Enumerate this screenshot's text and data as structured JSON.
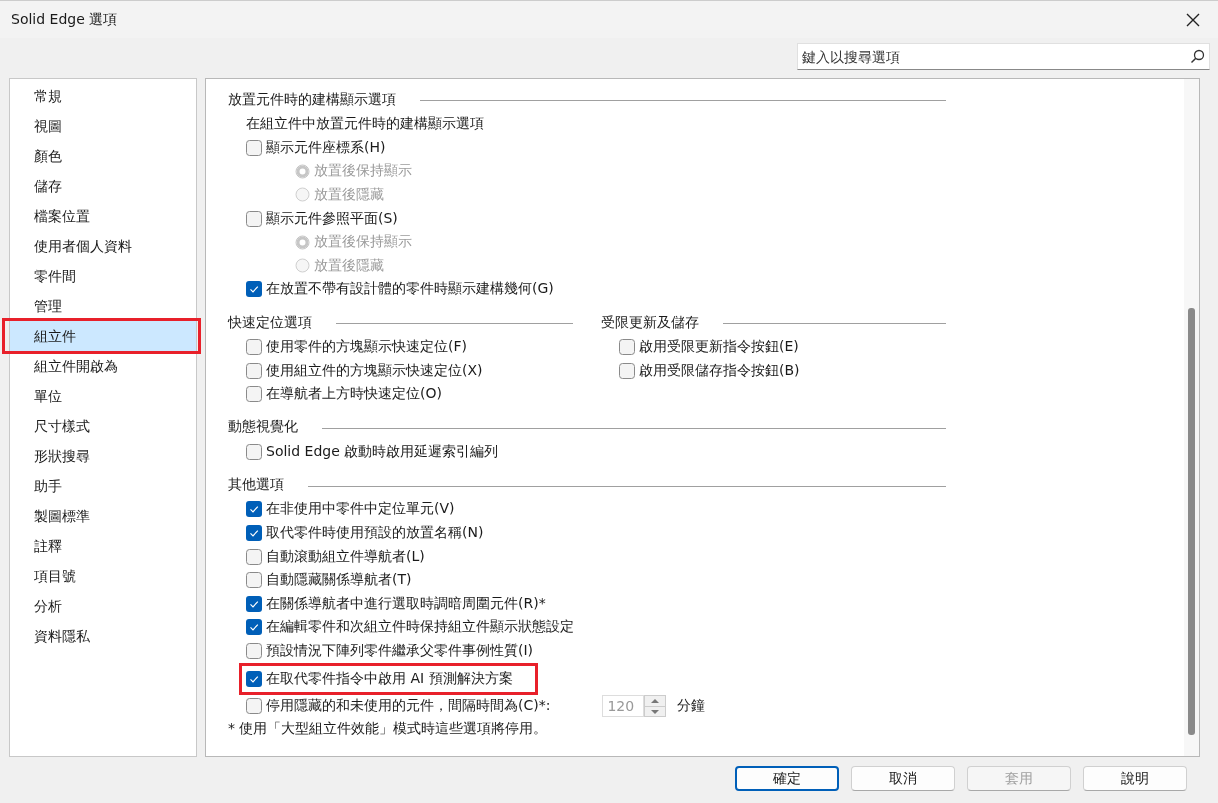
{
  "window": {
    "title": "Solid Edge 選項"
  },
  "search": {
    "placeholder": "鍵入以搜尋選項"
  },
  "sidebar": {
    "items": [
      {
        "label": "常規",
        "selected": false,
        "highlighted": false
      },
      {
        "label": "視圖",
        "selected": false,
        "highlighted": false
      },
      {
        "label": "顏色",
        "selected": false,
        "highlighted": false
      },
      {
        "label": "儲存",
        "selected": false,
        "highlighted": false
      },
      {
        "label": "檔案位置",
        "selected": false,
        "highlighted": false
      },
      {
        "label": "使用者個人資料",
        "selected": false,
        "highlighted": false
      },
      {
        "label": "零件間",
        "selected": false,
        "highlighted": false
      },
      {
        "label": "管理",
        "selected": false,
        "highlighted": false
      },
      {
        "label": "組立件",
        "selected": true,
        "highlighted": true
      },
      {
        "label": "組立件開啟為",
        "selected": false,
        "highlighted": false
      },
      {
        "label": "單位",
        "selected": false,
        "highlighted": false
      },
      {
        "label": "尺寸樣式",
        "selected": false,
        "highlighted": false
      },
      {
        "label": "形狀搜尋",
        "selected": false,
        "highlighted": false
      },
      {
        "label": "助手",
        "selected": false,
        "highlighted": false
      },
      {
        "label": "製圖標準",
        "selected": false,
        "highlighted": false
      },
      {
        "label": "註釋",
        "selected": false,
        "highlighted": false
      },
      {
        "label": "項目號",
        "selected": false,
        "highlighted": false
      },
      {
        "label": "分析",
        "selected": false,
        "highlighted": false
      },
      {
        "label": "資料隱私",
        "selected": false,
        "highlighted": false
      }
    ]
  },
  "content": {
    "rows": [
      [
        {
          "title": "放置元件時的建構顯示選項",
          "items": [
            {
              "kind": "text",
              "label": "在組立件中放置元件時的建構顯示選項"
            },
            {
              "kind": "checkbox",
              "label": "顯示元件座標系(H)",
              "checked": false,
              "children": [
                {
                  "kind": "radio",
                  "label": "放置後保持顯示",
                  "selected": true,
                  "disabled": true
                },
                {
                  "kind": "radio",
                  "label": "放置後隱藏",
                  "selected": false,
                  "disabled": true
                }
              ]
            },
            {
              "kind": "checkbox",
              "label": "顯示元件參照平面(S)",
              "checked": false,
              "children": [
                {
                  "kind": "radio",
                  "label": "放置後保持顯示",
                  "selected": true,
                  "disabled": true
                },
                {
                  "kind": "radio",
                  "label": "放置後隱藏",
                  "selected": false,
                  "disabled": true
                }
              ]
            },
            {
              "kind": "checkbox",
              "label": "在放置不帶有設計體的零件時顯示建構幾何(G)",
              "checked": true
            }
          ]
        }
      ],
      [
        {
          "title": "快速定位選項",
          "items": [
            {
              "kind": "checkbox",
              "label": "使用零件的方塊顯示快速定位(F)",
              "checked": false
            },
            {
              "kind": "checkbox",
              "label": "使用組立件的方塊顯示快速定位(X)",
              "checked": false
            },
            {
              "kind": "checkbox",
              "label": "在導航者上方時快速定位(O)",
              "checked": false
            }
          ]
        },
        {
          "title": "受限更新及儲存",
          "items": [
            {
              "kind": "checkbox",
              "label": "啟用受限更新指令按鈕(E)",
              "checked": false
            },
            {
              "kind": "checkbox",
              "label": "啟用受限儲存指令按鈕(B)",
              "checked": false
            }
          ]
        }
      ],
      [
        {
          "title": "動態視覺化",
          "items": [
            {
              "kind": "checkbox",
              "label": "Solid Edge 啟動時啟用延遲索引編列",
              "checked": false
            }
          ]
        }
      ],
      [
        {
          "title": "其他選項",
          "items": [
            {
              "kind": "checkbox",
              "label": "在非使用中零件中定位單元(V)",
              "checked": true
            },
            {
              "kind": "checkbox",
              "label": "取代零件時使用預設的放置名稱(N)",
              "checked": true
            },
            {
              "kind": "checkbox",
              "label": "自動滾動組立件導航者(L)",
              "checked": false
            },
            {
              "kind": "checkbox",
              "label": "自動隱藏關係導航者(T)",
              "checked": false
            },
            {
              "kind": "checkbox",
              "label": "在關係導航者中進行選取時調暗周圍元件(R)*",
              "checked": true
            },
            {
              "kind": "checkbox",
              "label": "在編輯零件和次組立件時保持組立件顯示狀態設定",
              "checked": true
            },
            {
              "kind": "checkbox",
              "label": "預設情況下陣列零件繼承父零件事例性質(I)",
              "checked": false
            },
            {
              "kind": "checkbox",
              "label": "在取代零件指令中啟用 AI 預測解決方案",
              "checked": true,
              "highlighted": true
            },
            {
              "kind": "checkbox",
              "label": "停用隱藏的和未使用的元件，間隔時間為(C)*:",
              "checked": false,
              "spinner": {
                "value": "120",
                "unit": "分鐘",
                "disabled": true
              }
            },
            {
              "kind": "note",
              "label": "* 使用「大型組立件效能」模式時這些選項將停用。"
            }
          ]
        }
      ]
    ]
  },
  "buttons": [
    {
      "label": "確定",
      "default": true,
      "disabled": false
    },
    {
      "label": "取消",
      "default": false,
      "disabled": false
    },
    {
      "label": "套用",
      "default": false,
      "disabled": true
    },
    {
      "label": "說明",
      "default": false,
      "disabled": false
    }
  ]
}
